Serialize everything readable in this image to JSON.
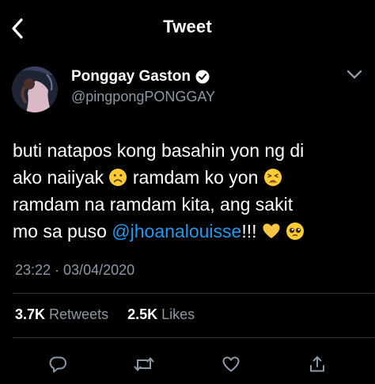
{
  "header": {
    "title": "Tweet",
    "back_icon": "chevron-left-icon"
  },
  "author": {
    "display_name": "Ponggay Gaston",
    "handle": "@pingpongPONGGAY",
    "verified_icon": "verified-badge-icon",
    "menu_icon": "chevron-down-icon"
  },
  "tweet": {
    "line1": "buti natapos kong basahin yon ng di",
    "line2_a": "ako naiiyak",
    "line2_emoji": "frowning-face-emoji",
    "line2_b": "ramdam ko yon",
    "line2_emoji2": "weary-face-emoji",
    "line3": "ramdam na ramdam kita, ang sakit",
    "line4_a": "mo sa puso",
    "mention": "@jhoanalouisse",
    "line4_b": "!!!",
    "line4_emoji1": "yellow-heart-emoji",
    "line4_emoji2": "pleading-face-emoji"
  },
  "timestamp": "23:22 · 03/04/2020",
  "stats": {
    "retweets_count": "3.7K",
    "retweets_label": "Retweets",
    "likes_count": "2.5K",
    "likes_label": "Likes"
  },
  "actions": [
    "reply-icon",
    "retweet-icon",
    "like-icon",
    "share-icon"
  ],
  "colors": {
    "background": "#000000",
    "text": "#ffffff",
    "secondary_text": "#8b98a5",
    "mention": "#1d9bf0",
    "divider": "#2f3336"
  }
}
